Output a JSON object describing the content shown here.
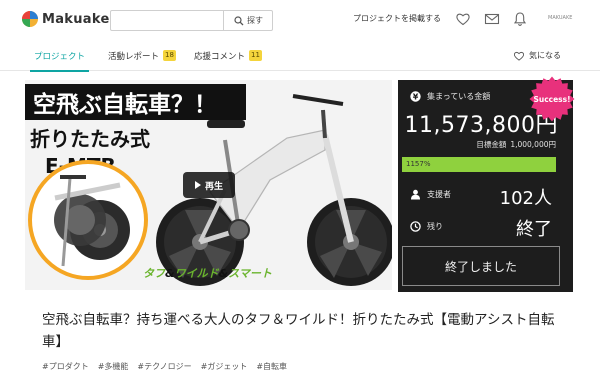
{
  "header": {
    "logo_text": "Makuake",
    "search_placeholder": "",
    "search_button": "探す",
    "post_project": "プロジェクトを掲載する",
    "user_label": "MAKUAKE"
  },
  "tabs": [
    {
      "label": "プロジェクト",
      "badge": ""
    },
    {
      "label": "活動レポート",
      "badge": "18"
    },
    {
      "label": "応援コメント",
      "badge": "11"
    }
  ],
  "favorite_label": "気になる",
  "hero": {
    "headline": "空飛ぶ自転車？！",
    "subline_1": "折りたたみ式",
    "subline_2": "E-MTB",
    "tagline_a": "タフ",
    "tagline_amp1": "&",
    "tagline_b": "ワイルド",
    "tagline_amp2": "&",
    "tagline_c": "スマート",
    "play_label": "再生"
  },
  "stats": {
    "raised_label": "集まっている金額",
    "raised_amount": "11,573,800円",
    "goal_label": "目標金額",
    "goal_amount": "1,000,000円",
    "progress_text": "1157%",
    "progress_fraction": 1.0,
    "supporters_label": "支援者",
    "supporters_value": "102人",
    "remaining_label": "残り",
    "remaining_value": "終了",
    "ended_button": "終了しました",
    "success_badge": "Success!"
  },
  "project": {
    "title": "空飛ぶ自転車？持ち運べる大人のタフ＆ワイルド！折りたたみ式【電動アシスト自転車】",
    "tags": [
      "#プロダクト",
      "#多機能",
      "#テクノロジー",
      "#ガジェット",
      "#自転車"
    ]
  },
  "colors": {
    "accent": "#0ea5a3",
    "badge": "#f4d43c",
    "panel_bg": "#1d1d1d",
    "progress": "#8fd13e",
    "success": "#e8317c",
    "headline_red": "#e21b1b",
    "tagline_green": "#6ab42d",
    "ring_orange": "#f5a623"
  },
  "icons": {
    "logo": "makuake-logo-icon",
    "search": "search-icon",
    "heart": "heart-icon",
    "mail": "mail-icon",
    "bell": "bell-icon",
    "yen": "yen-icon",
    "person": "person-icon",
    "clock": "clock-icon",
    "play": "play-icon"
  }
}
